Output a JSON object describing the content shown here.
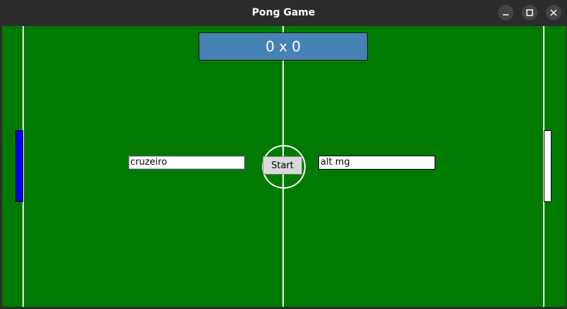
{
  "window": {
    "title": "Pong Game",
    "controls": [
      "minimize-icon",
      "maximize-icon",
      "close-icon"
    ]
  },
  "scoreboard": {
    "text": "0 x 0"
  },
  "players": {
    "left_name": "cruzeiro",
    "right_name": "alt mg"
  },
  "controls": {
    "start_label": "Start"
  },
  "colors": {
    "field": "#007a00",
    "scoreboard": "#4682b4",
    "left_paddle": "#0000ff",
    "right_paddle": "#ffffff",
    "lines": "#ffffff"
  }
}
